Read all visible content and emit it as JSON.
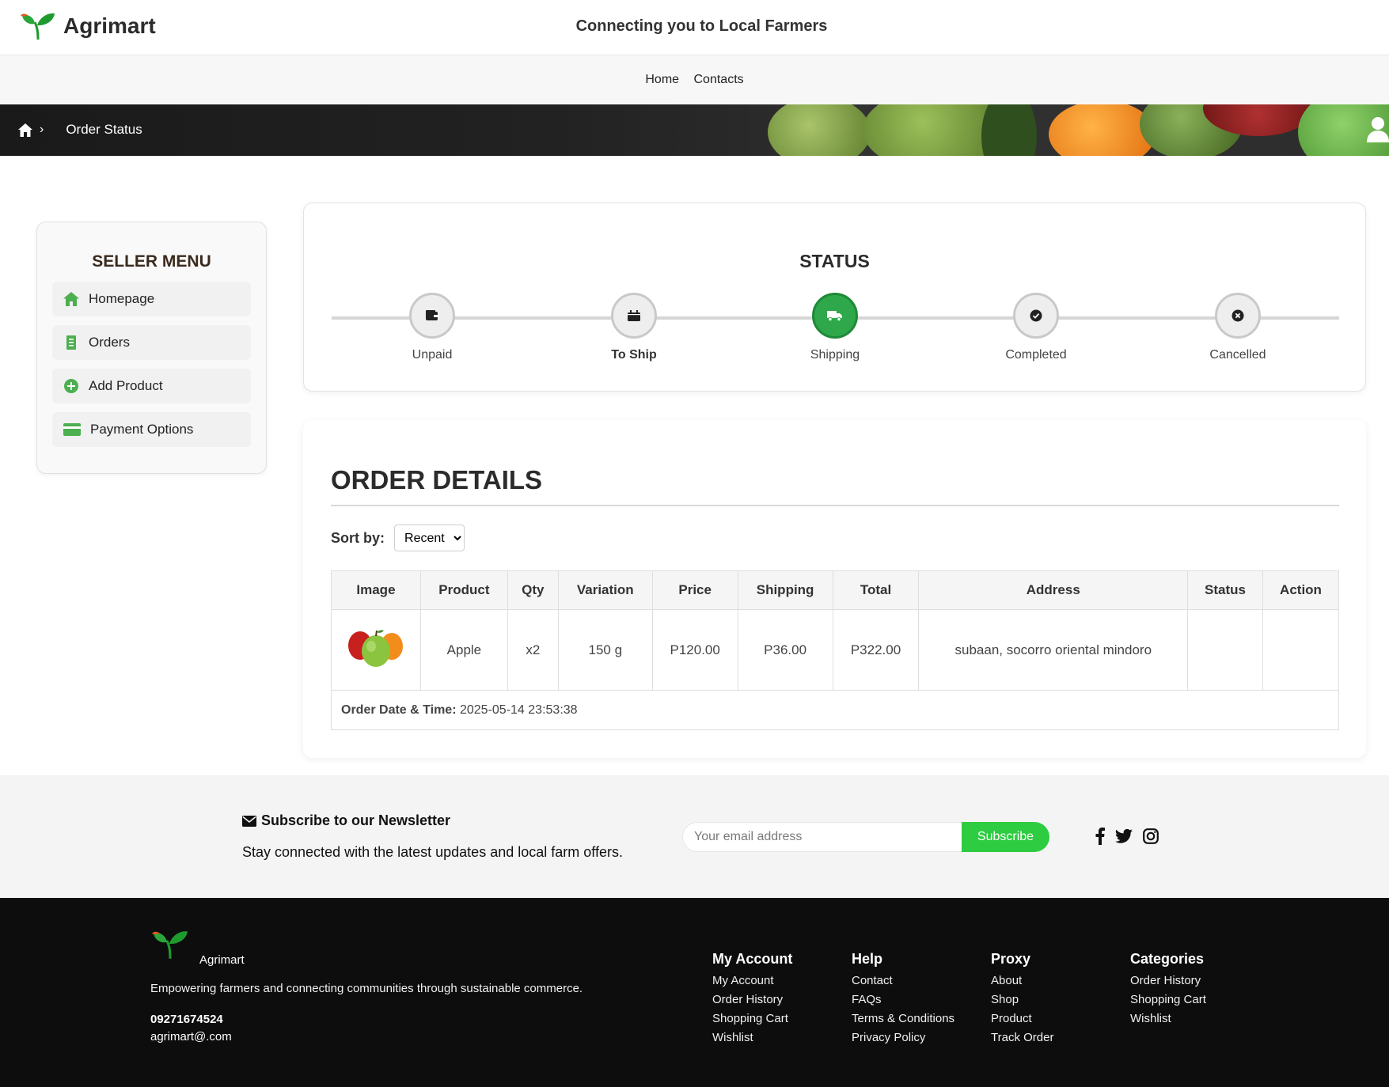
{
  "header": {
    "brand": "Agrimart",
    "tagline": "Connecting you to Local Farmers"
  },
  "nav": {
    "items": [
      "Home",
      "Contacts"
    ]
  },
  "breadcrumb": {
    "separator": "›",
    "current": "Order Status"
  },
  "sidebar": {
    "title": "SELLER MENU",
    "items": [
      {
        "label": "Homepage",
        "icon": "home-icon"
      },
      {
        "label": "Orders",
        "icon": "receipt-icon"
      },
      {
        "label": "Add Product",
        "icon": "plus-circle-icon"
      },
      {
        "label": "Payment Options",
        "icon": "credit-card-icon"
      }
    ],
    "accent": "#4caf50"
  },
  "status": {
    "title": "STATUS",
    "steps": [
      {
        "label": "Unpaid",
        "icon": "wallet-icon"
      },
      {
        "label": "To Ship",
        "icon": "box-icon"
      },
      {
        "label": "Shipping",
        "icon": "truck-icon"
      },
      {
        "label": "Completed",
        "icon": "check-circle-icon"
      },
      {
        "label": "Cancelled",
        "icon": "x-circle-icon"
      }
    ],
    "active_step": "Shipping",
    "active_color": "#2ea84a"
  },
  "order": {
    "title": "ORDER DETAILS",
    "sort_label": "Sort by:",
    "sort_value": "Recent",
    "columns": [
      "Image",
      "Product",
      "Qty",
      "Variation",
      "Price",
      "Shipping",
      "Total",
      "Address",
      "Status",
      "Action"
    ],
    "rows": [
      {
        "image": "apples-image",
        "product": "Apple",
        "qty": "x2",
        "variation": "150 g",
        "price": "P120.00",
        "shipping": "P36.00",
        "total": "P322.00",
        "address": "subaan, socorro oriental mindoro",
        "status": "",
        "action": ""
      }
    ],
    "date_label": "Order Date & Time:",
    "date_value": "2025-05-14 23:53:38"
  },
  "newsletter": {
    "title": "Subscribe to our Newsletter",
    "subtitle": "Stay connected with the latest updates and local farm offers.",
    "placeholder": "Your email address",
    "button": "Subscribe",
    "button_color": "#2ecc40",
    "social": [
      "facebook-icon",
      "twitter-icon",
      "instagram-icon"
    ]
  },
  "footer": {
    "name": "Agrimart",
    "description": "Empowering farmers and connecting communities through sustainable commerce.",
    "phone": "09271674524",
    "email": "agrimart@.com",
    "columns": [
      {
        "title": "My Account",
        "links": [
          "My Account",
          "Order History",
          "Shopping Cart",
          "Wishlist"
        ]
      },
      {
        "title": "Help",
        "links": [
          "Contact",
          "FAQs",
          "Terms & Conditions",
          "Privacy Policy"
        ]
      },
      {
        "title": "Proxy",
        "links": [
          "About",
          "Shop",
          "Product",
          "Track Order"
        ]
      },
      {
        "title": "Categories",
        "links": [
          "Order History",
          "Shopping Cart",
          "Wishlist"
        ]
      }
    ]
  }
}
